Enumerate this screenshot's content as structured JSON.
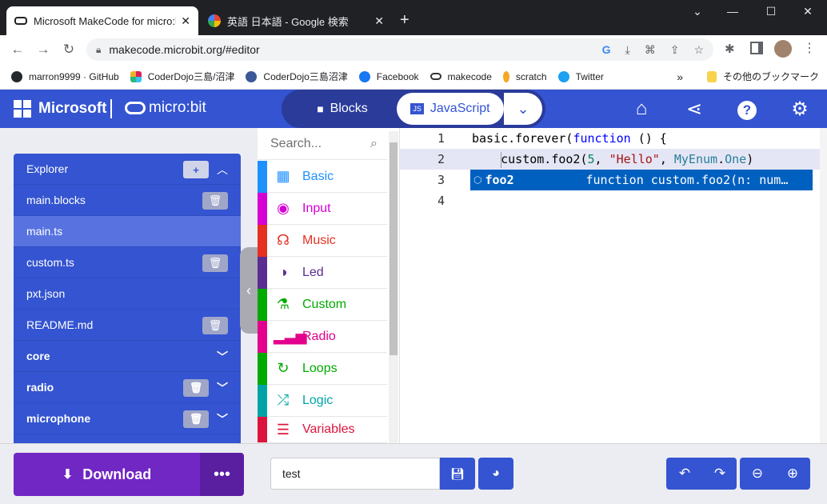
{
  "browser": {
    "tabs": [
      {
        "title": "Microsoft MakeCode for micro:bit",
        "close": "✕"
      },
      {
        "title": "英語 日本語 - Google 検索",
        "close": "✕"
      }
    ],
    "new_tab": "+",
    "url": "makecode.microbit.org/#editor",
    "bookmarks": [
      {
        "label": "marron9999 · GitHub",
        "icon": "github-icon",
        "color": "#24292e"
      },
      {
        "label": "CoderDojo三島/沼津",
        "icon": "slack-icon",
        "color": "#e01e5a"
      },
      {
        "label": "CoderDojo三島沼津",
        "icon": "dojo-icon",
        "color": "#3b5998"
      },
      {
        "label": "Facebook",
        "icon": "facebook-icon",
        "color": "#1877f2"
      },
      {
        "label": "makecode",
        "icon": "makecode-icon",
        "color": "#333333"
      },
      {
        "label": "scratch",
        "icon": "scratch-icon",
        "color": "#f5a623"
      },
      {
        "label": "Twitter",
        "icon": "twitter-icon",
        "color": "#1da1f2"
      }
    ],
    "more_bookmarks": "»",
    "other_bookmarks": "その他のブックマーク"
  },
  "header": {
    "brand": "Microsoft",
    "product": "micro:bit",
    "blocks_label": "Blocks",
    "js_label": "JavaScript",
    "js_badge": "JS",
    "accent": "#3454d1"
  },
  "explorer": {
    "title": "Explorer",
    "files": [
      {
        "name": "main.blocks"
      },
      {
        "name": "main.ts"
      },
      {
        "name": "custom.ts"
      },
      {
        "name": "pxt.json"
      },
      {
        "name": "README.md"
      },
      {
        "name": "core"
      },
      {
        "name": "radio"
      },
      {
        "name": "microphone"
      }
    ]
  },
  "toolbox": {
    "search_placeholder": "Search...",
    "categories": [
      {
        "label": "Basic",
        "color": "#1e90ff"
      },
      {
        "label": "Input",
        "color": "#d400d4"
      },
      {
        "label": "Music",
        "color": "#e63022"
      },
      {
        "label": "Led",
        "color": "#5c2d91"
      },
      {
        "label": "Custom",
        "color": "#00aa00"
      },
      {
        "label": "Radio",
        "color": "#e3008c"
      },
      {
        "label": "Loops",
        "color": "#00aa00"
      },
      {
        "label": "Logic",
        "color": "#00a4a6"
      },
      {
        "label": "Variables",
        "color": "#dc143c"
      }
    ]
  },
  "code": {
    "line_numbers": [
      "1",
      "2",
      "3",
      "4"
    ],
    "line1": {
      "a": "basic.forever(",
      "b": "function",
      "c": " () {"
    },
    "line2": {
      "a": "    custom.foo2(",
      "b": "5",
      "c": ", ",
      "d": "\"Hello\"",
      "e": ", ",
      "f": "MyEnum",
      "g": ".",
      "h": "One",
      "i": ")"
    },
    "suggestion": {
      "name": "foo2",
      "detail": "function custom.foo2(n: num…"
    }
  },
  "footer": {
    "download_label": "Download",
    "more_label": "•••",
    "project_name": "test"
  }
}
